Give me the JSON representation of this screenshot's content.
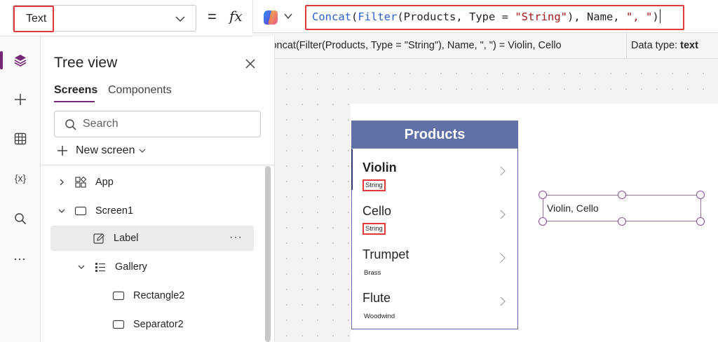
{
  "formula_bar": {
    "property": "Text",
    "equals": "=",
    "fx": "fx",
    "formula": {
      "p1": "Concat",
      "p2": "(",
      "p3": "Filter",
      "p4": "(Products, Type = ",
      "p5": "\"String\"",
      "p6": "), Name, ",
      "p7": "\", \"",
      "p8": ")"
    },
    "eval_result": "Concat(Filter(Products, Type = \"String\"), Name, \", \")  =  Violin, Cello",
    "data_type_label": "Data type:",
    "data_type_value": "text"
  },
  "rail": {
    "variables_label": "{x}",
    "more_label": "..."
  },
  "tree_view": {
    "title": "Tree view",
    "tabs": [
      "Screens",
      "Components"
    ],
    "search_placeholder": "Search",
    "new_screen_label": "New screen",
    "nodes": [
      "App",
      "Screen1",
      "Label",
      "Gallery",
      "Rectangle2",
      "Separator2"
    ],
    "more_label": "···"
  },
  "canvas": {
    "gallery_title": "Products",
    "items": [
      {
        "name": "Violin",
        "type": "String"
      },
      {
        "name": "Cello",
        "type": "String"
      },
      {
        "name": "Trumpet",
        "type": "Brass"
      },
      {
        "name": "Flute",
        "type": "Woodwind"
      }
    ],
    "label_text": "Violin, Cello"
  },
  "colors": {
    "accent": "#742774",
    "highlight_box": "#e03a3a",
    "gallery_header": "#6170a6",
    "function_blue": "#2a60c9",
    "string_red": "#a31515"
  }
}
